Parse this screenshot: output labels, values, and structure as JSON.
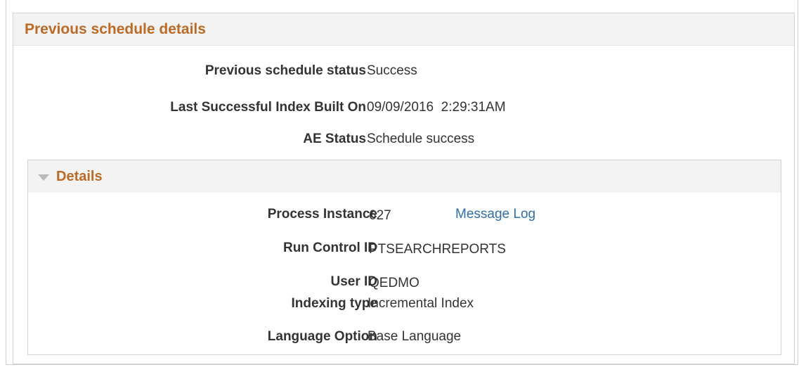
{
  "panel": {
    "title": "Previous schedule details",
    "fields": [
      {
        "label": "Previous schedule status",
        "value": "Success"
      },
      {
        "label": "Last Successful Index Built On",
        "value": "09/09/2016  2:29:31AM"
      },
      {
        "label": "AE Status",
        "value": "Schedule success"
      }
    ]
  },
  "details": {
    "title": "Details",
    "process_instance": {
      "label": "Process Instance",
      "value": "627",
      "link": "Message Log"
    },
    "run_control_id": {
      "label": "Run Control ID",
      "value": "PTSEARCHREPORTS"
    },
    "user_id": {
      "label": "User ID",
      "value": "QEDMO"
    },
    "indexing_type": {
      "label": "Indexing type",
      "value": "Incremental Index"
    },
    "language_option": {
      "label": "Language Option",
      "value": "Base Language"
    }
  },
  "icons": {
    "collapse": "triangle-down-icon"
  },
  "colors": {
    "title": "#bd6a26",
    "link": "#2f6ea8",
    "header_bg": "#f3f3f3"
  }
}
